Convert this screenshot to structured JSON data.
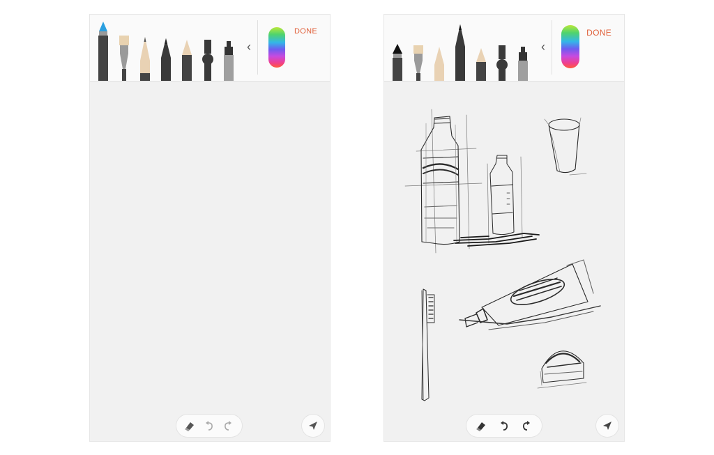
{
  "screens": {
    "left": {
      "done_label": "DONE",
      "collapse_icon": "chevron-left-icon",
      "pen_tools": [
        "brush-icon",
        "flat-brush-icon",
        "pencil-icon",
        "fine-pencil-icon",
        "crayon-icon",
        "fountain-pen-icon",
        "marker-icon"
      ],
      "selected_tool": "brush-icon",
      "accent_color": "#2a9fe0",
      "canvas": "blank"
    },
    "right": {
      "done_label": "DONE",
      "collapse_icon": "chevron-left-icon",
      "pen_tools": [
        "brush-icon",
        "flat-brush-icon",
        "pencil-icon",
        "fine-pencil-icon",
        "crayon-icon",
        "fountain-pen-icon",
        "marker-icon"
      ],
      "selected_tool": "fine-pencil-icon",
      "accent_color": "#1a1a1a",
      "canvas": "sketch"
    }
  },
  "colors": {
    "done_text": "#e0603a",
    "toolbar_bg": "#fafafa",
    "canvas_bg": "#f1f1f1"
  },
  "bottom_bar_icons": [
    "eraser-icon",
    "undo-icon",
    "redo-icon",
    "send-icon"
  ]
}
